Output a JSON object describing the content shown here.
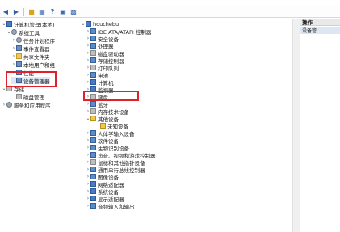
{
  "toolbar": {
    "back_icon": "arrow-left-icon",
    "forward_icon": "arrow-right-icon"
  },
  "left_tree": {
    "root": "计算机管理(本地)",
    "system_tools": "系统工具",
    "task_scheduler": "任务计划程序",
    "event_viewer": "事件查看器",
    "shared_folders": "共享文件夹",
    "local_users": "本地用户和组",
    "performance": "性能",
    "device_manager": "设备管理器",
    "storage": "存储",
    "disk_management": "磁盘管理",
    "services_apps": "服务和应用程序"
  },
  "device_tree": {
    "computer": "houchebu",
    "items": [
      "IDE ATA/ATAPI 控制器",
      "安全设备",
      "处理器",
      "磁盘驱动器",
      "存储控制器",
      "打印队列",
      "电池",
      "计算机",
      "监视器",
      "键盘",
      "蓝牙",
      "内存技术设备",
      "其他设备",
      "未知设备",
      "人体学输入设备",
      "软件设备",
      "生物识别设备",
      "声音、视频和游戏控制器",
      "鼠标和其他指针设备",
      "通用串行总线控制器",
      "图像设备",
      "网络适配器",
      "系统设备",
      "显示适配器",
      "音频输入和输出"
    ]
  },
  "actions_panel": {
    "header": "操作",
    "subheader": "设备管"
  },
  "highlight_color": "#e0202a"
}
